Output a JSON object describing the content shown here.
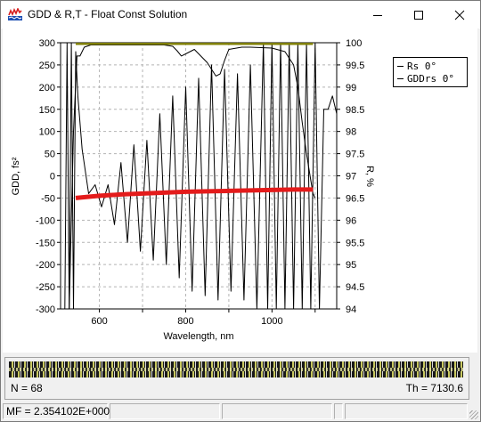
{
  "window": {
    "title": "GDD & R,T - Float Const Solution",
    "minimize_icon": "minimize-icon",
    "maximize_icon": "maximize-icon",
    "close_icon": "close-icon"
  },
  "chart_data": {
    "type": "line",
    "xlabel": "Wavelength, nm",
    "ylabel_left": "GDD, fs²",
    "ylabel_right": "R, %",
    "xlim": [
      510,
      1150
    ],
    "ylim_left": [
      -300,
      300
    ],
    "ylim_right": [
      94,
      100
    ],
    "x_ticks": [
      "600",
      "800",
      "1000"
    ],
    "y_ticks_left": [
      "300",
      "250",
      "200",
      "150",
      "100",
      "50",
      "0",
      "-50",
      "-100",
      "-150",
      "-200",
      "-250",
      "-300"
    ],
    "y_ticks_right": [
      "100",
      "99.5",
      "99",
      "98.5",
      "98",
      "97.5",
      "97",
      "96.5",
      "96",
      "95.5",
      "95",
      "94.5",
      "94"
    ],
    "grid": true,
    "legend_position": "top-right",
    "series": [
      {
        "name": "Rs 0°",
        "axis": "right",
        "color": "#000000",
        "x": [
          530,
          540,
          548,
          555,
          565,
          580,
          600,
          650,
          700,
          750,
          770,
          780,
          790,
          800,
          820,
          850,
          870,
          880,
          890,
          900,
          930,
          950,
          1000,
          1030,
          1050,
          1060,
          1070,
          1080,
          1090,
          1095,
          1100
        ],
        "y": [
          94.0,
          98.0,
          99.7,
          99.7,
          99.9,
          99.95,
          99.95,
          99.95,
          99.95,
          99.95,
          99.92,
          99.82,
          99.7,
          99.75,
          99.85,
          99.55,
          99.25,
          99.3,
          99.6,
          99.85,
          99.9,
          99.9,
          99.88,
          99.8,
          99.5,
          99.0,
          98.2,
          97.5,
          96.9,
          96.6,
          96.5
        ]
      },
      {
        "name": "GDDrs 0°",
        "axis": "left",
        "color": "#000000",
        "x": [
          520,
          525,
          530,
          535,
          540,
          545,
          550,
          560,
          575,
          590,
          605,
          620,
          635,
          650,
          665,
          680,
          695,
          710,
          725,
          740,
          755,
          770,
          785,
          800,
          815,
          830,
          845,
          860,
          875,
          890,
          905,
          920,
          935,
          950,
          965,
          980,
          990,
          1000,
          1010,
          1020,
          1030,
          1040,
          1050,
          1060,
          1070,
          1080,
          1090,
          1100,
          1110,
          1120,
          1130,
          1140,
          1150
        ],
        "y": [
          -300,
          300,
          -300,
          300,
          -300,
          280,
          180,
          60,
          -40,
          -20,
          -70,
          -20,
          -110,
          30,
          -150,
          70,
          -170,
          80,
          -190,
          140,
          -200,
          180,
          -230,
          200,
          -260,
          220,
          -270,
          250,
          -280,
          240,
          -260,
          230,
          -280,
          250,
          -300,
          300,
          -300,
          300,
          -300,
          300,
          -300,
          300,
          -300,
          300,
          -300,
          300,
          -300,
          300,
          -300,
          150,
          150,
          180,
          140
        ]
      },
      {
        "name": "",
        "axis": "right",
        "color": "#e41b1b",
        "x": [
          545,
          600,
          650,
          700,
          750,
          800,
          850,
          900,
          950,
          1000,
          1050,
          1095
        ],
        "y": [
          96.5,
          96.55,
          96.58,
          96.6,
          96.62,
          96.64,
          96.65,
          96.66,
          96.67,
          96.68,
          96.69,
          96.69
        ]
      },
      {
        "name": "",
        "axis": "right",
        "color": "#808000",
        "x": [
          545,
          1095
        ],
        "y": [
          100,
          100
        ]
      }
    ]
  },
  "legend": {
    "items": [
      {
        "label": "Rs 0°"
      },
      {
        "label": "GDDrs 0°"
      }
    ]
  },
  "layers": {
    "count_label": "N = 68",
    "thickness_label": "Th = 7130.6"
  },
  "status": {
    "mf_label": "MF = 2.354102E+000"
  }
}
